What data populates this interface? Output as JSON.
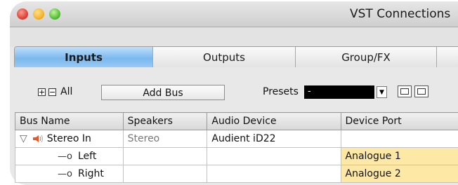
{
  "window": {
    "title": "VST Connections"
  },
  "tabs": [
    {
      "label": "Inputs",
      "active": true
    },
    {
      "label": "Outputs",
      "active": false
    },
    {
      "label": "Group/FX",
      "active": false
    },
    {
      "label": "",
      "active": false
    }
  ],
  "controls": {
    "all_label": "All",
    "expand_symbol": "+",
    "collapse_symbol": "−",
    "add_bus_label": "Add Bus",
    "presets_label": "Presets",
    "preset_value": "-"
  },
  "table": {
    "headers": [
      "Bus Name",
      "Speakers",
      "Audio Device",
      "Device Port"
    ],
    "rows": [
      {
        "bus": "Stereo In",
        "speakers": "Stereo",
        "device": "Audient iD22",
        "port": ""
      },
      {
        "bus": "Left",
        "speakers": "",
        "device": "",
        "port": "Analogue 1"
      },
      {
        "bus": "Right",
        "speakers": "",
        "device": "",
        "port": "Analogue 2"
      }
    ]
  },
  "colors": {
    "active_tab": "#7ab8ee",
    "port_highlight": "#fde8a6",
    "speaker_icon": "#e05a2a"
  }
}
